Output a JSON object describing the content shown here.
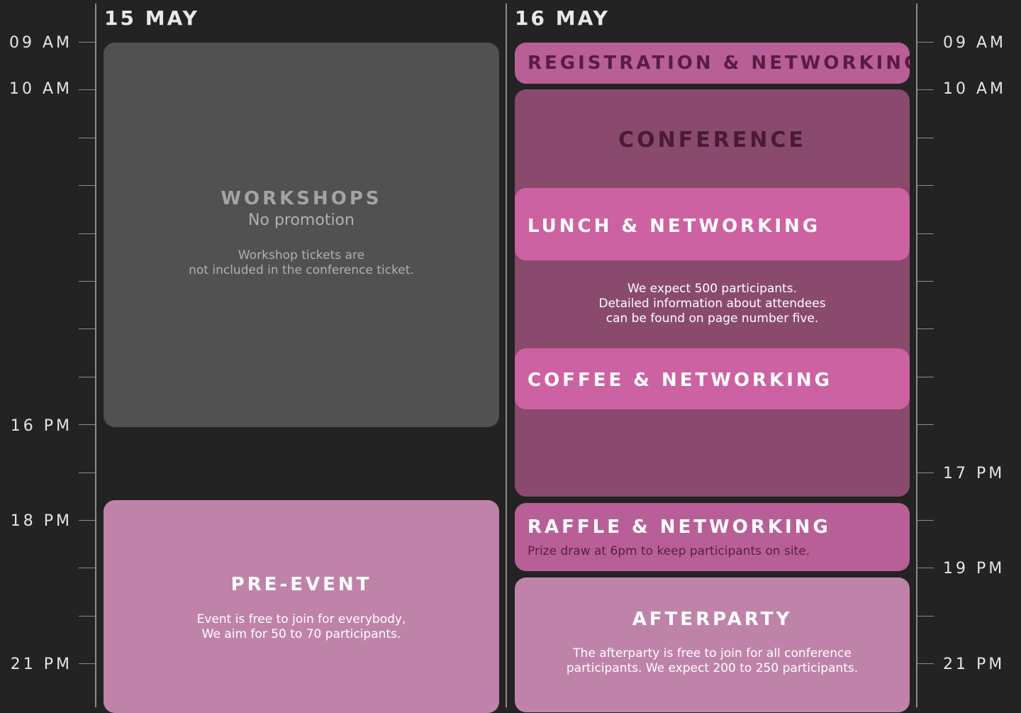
{
  "days": [
    {
      "label": "15 MAY"
    },
    {
      "label": "16 MAY"
    }
  ],
  "time_labels_left": [
    "09 AM",
    "10 AM",
    "16 PM",
    "18 PM",
    "21 PM"
  ],
  "time_labels_right": [
    "09 AM",
    "10 AM",
    "17 PM",
    "19 PM",
    "21 PM"
  ],
  "events": {
    "workshops": {
      "title": "WORKSHOPS",
      "subtitle": "No promotion",
      "text": "Workshop tickets are\nnot included in the conference ticket."
    },
    "pre_event": {
      "title": "PRE-EVENT",
      "text": "Event is free to join for everybody,\nWe aim for 50 to 70 participants."
    },
    "registration": {
      "title": "REGISTRATION & NETWORKING"
    },
    "conference": {
      "title": "CONFERENCE",
      "text": "We expect 500 participants.\nDetailed information about attendees\ncan be found on page number five."
    },
    "lunch": {
      "title": "LUNCH & NETWORKING"
    },
    "coffee": {
      "title": "COFFEE & NETWORKING"
    },
    "raffle": {
      "title": "RAFFLE & NETWORKING",
      "text": "Prize draw at 6pm to keep participants on site."
    },
    "afterparty": {
      "title": "AFTERPARTY",
      "text": "The afterparty is free to join for all conference\nparticipants. We expect 200 to 250 participants."
    }
  },
  "colors": {
    "background": "#232323",
    "workshop_grey": "#515151",
    "light_pink": "#bf83a9",
    "mid_pink": "#b95f98",
    "bright_pink": "#cd62a2",
    "conference_plum": "#894a6e",
    "dark_plum_text": "#5a1c42"
  }
}
